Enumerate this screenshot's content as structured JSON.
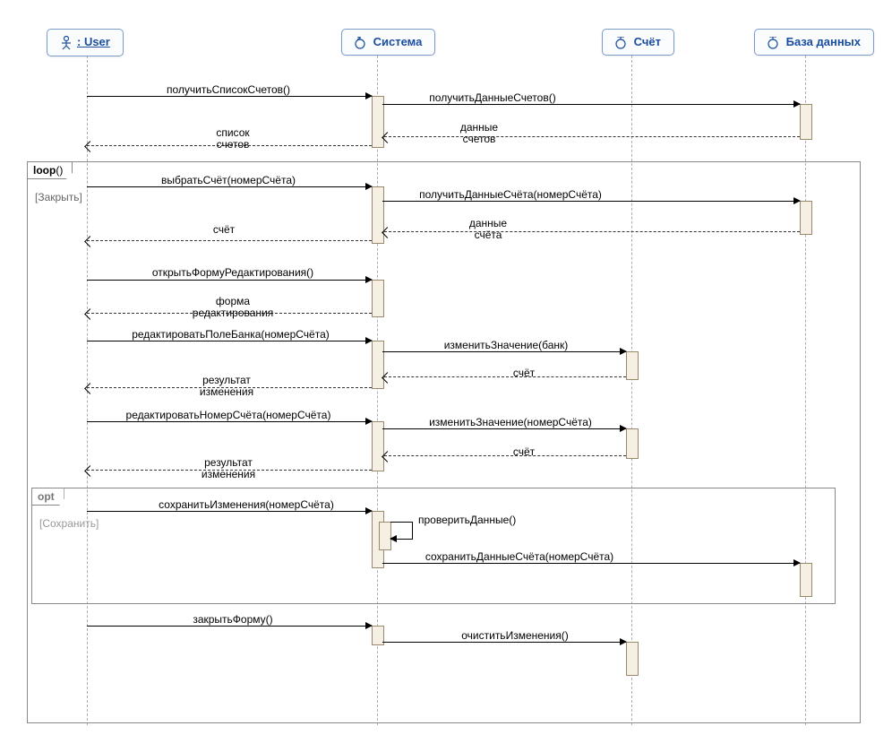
{
  "participants": {
    "user": ": User",
    "system": "Система",
    "account": "Счёт",
    "db": "База данных"
  },
  "fragments": {
    "loop": {
      "label": "loop",
      "paren": "()",
      "guard": "[Закрыть]"
    },
    "opt": {
      "label": "opt",
      "guard": "[Сохранить]"
    }
  },
  "messages": {
    "m1": "получитьСписокСчетов()",
    "m2": "получитьДанныеСчетов()",
    "r2a": "данные",
    "r2b": "счетов",
    "r1a": "список",
    "r1b": "счетов",
    "m3": "выбратьСчёт(номерСчёта)",
    "m4": "получитьДанныеСчёта(номерСчёта)",
    "r4a": "данные",
    "r4b": "счёта",
    "r3": "счёт",
    "m5": "открытьФормуРедактирования()",
    "r5a": "форма",
    "r5b": "редактирования",
    "m6": "редактироватьПолеБанка(номерСчёта)",
    "m7": "изменитьЗначение(банк)",
    "r7": "счёт",
    "r6a": "результат",
    "r6b": "изменения",
    "m8": "редактироватьНомерСчёта(номерСчёта)",
    "m9": "изменитьЗначение(номерСчёта)",
    "r9": "счёт",
    "r8a": "результат",
    "r8b": "изменения",
    "m10": "сохранитьИзменения(номерСчёта)",
    "m11": "проверитьДанные()",
    "m12": "сохранитьДанныеСчёта(номерСчёта)",
    "m13": "закрытьФорму()",
    "m14": "очиститьИзменения()"
  }
}
